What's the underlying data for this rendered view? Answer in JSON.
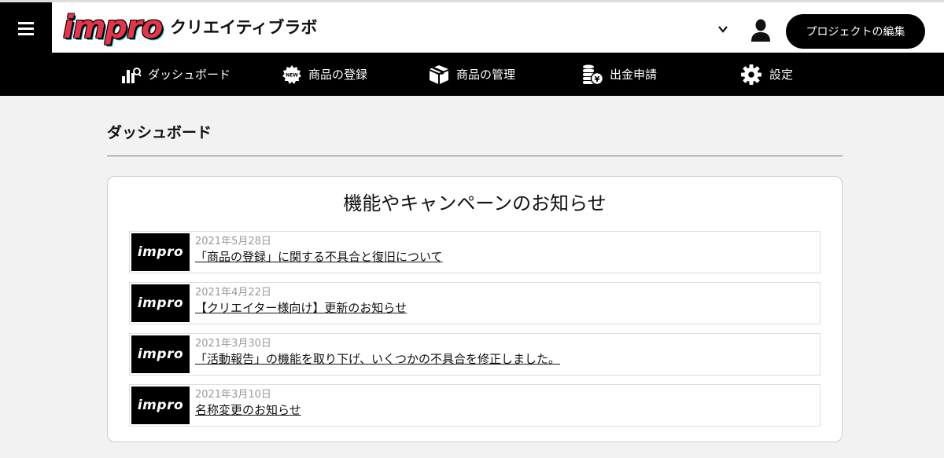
{
  "header": {
    "logo_text": "impro",
    "brand_name": "クリエイティブラボ",
    "edit_button": "プロジェクトの編集"
  },
  "nav": {
    "items": [
      {
        "label": "ダッシュボード",
        "icon": "chart-icon"
      },
      {
        "label": "商品の登録",
        "icon": "new-badge-icon"
      },
      {
        "label": "商品の管理",
        "icon": "box-icon"
      },
      {
        "label": "出金申請",
        "icon": "coins-yen-icon"
      },
      {
        "label": "設定",
        "icon": "gear-icon"
      }
    ]
  },
  "main": {
    "page_title": "ダッシュボード",
    "card_title": "機能やキャンペーンのお知らせ",
    "news": [
      {
        "thumb": "impro",
        "date": "2021年5月28日",
        "title": "「商品の登録」に関する不具合と復旧について"
      },
      {
        "thumb": "impro",
        "date": "2021年4月22日",
        "title": "【クリエイター様向け】更新のお知らせ"
      },
      {
        "thumb": "impro",
        "date": "2021年3月30日",
        "title": "「活動報告」の機能を取り下げ、いくつかの不具合を修正しました。"
      },
      {
        "thumb": "impro",
        "date": "2021年3月10日",
        "title": "名称変更のお知らせ"
      }
    ]
  },
  "colors": {
    "nav_bg": "#000000",
    "logo_red": "#e8334a",
    "logo_cyan": "#3ad6e0",
    "page_bg": "#f2f2f2"
  }
}
